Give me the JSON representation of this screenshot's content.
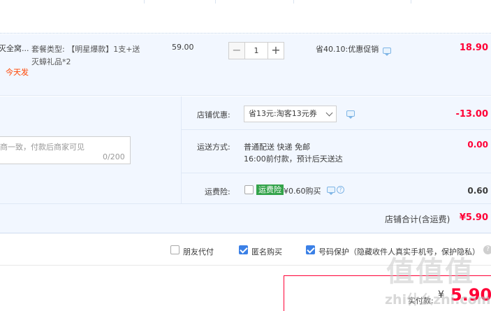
{
  "item": {
    "title_truncated": "灭全窝...",
    "ship_today": "今天发",
    "spec_line1": "套餐类型: 【明星爆款】1支+送",
    "spec_line2": "灭蟑礼品*2",
    "unit_price": "59.00",
    "quantity": "1",
    "minus_symbol": "−",
    "plus_symbol": "+",
    "promo": "省40.10:优惠促销",
    "line_total": "18.90"
  },
  "shop": {
    "discount_label": "店铺优惠:",
    "coupon_selected": "省13元:淘客13元券",
    "discount_amount": "-13.00",
    "memo_placeholder": "商一致，付款后商家可见",
    "memo_count": "0/200",
    "shipping_label": "运送方式:",
    "shipping_method": "普通配送 快递 免邮",
    "shipping_note": "16:00前付款，预计后天送达",
    "shipping_amount": "0.00",
    "insurance_label": "运费险:",
    "insurance_badge": "运费险",
    "insurance_price": "¥0.60购买",
    "insurance_amount": "0.60",
    "total_label": "店铺合计(含运费)",
    "total_value": "¥5.90"
  },
  "options": {
    "friend_pay": "朋友代付",
    "anonymous": "匿名购买",
    "number_protect": "号码保护（隐藏收件人真实手机号，保护隐私）",
    "friend_pay_checked": false,
    "anonymous_checked": true,
    "number_protect_checked": true
  },
  "pay": {
    "label": "实付款:",
    "currency": "¥",
    "amount": "5.90"
  },
  "watermark": {
    "big": "值值值",
    "small": "zhi什么zhi.com"
  },
  "colors": {
    "accent_red": "#ff0036",
    "checkbox_blue": "#3b80e6",
    "badge_green": "#33a34a",
    "row_bg": "#f2f7ff"
  },
  "icons": [
    "chat-bubble-icon",
    "help-icon",
    "chevron-down-icon",
    "checkmark-icon"
  ]
}
